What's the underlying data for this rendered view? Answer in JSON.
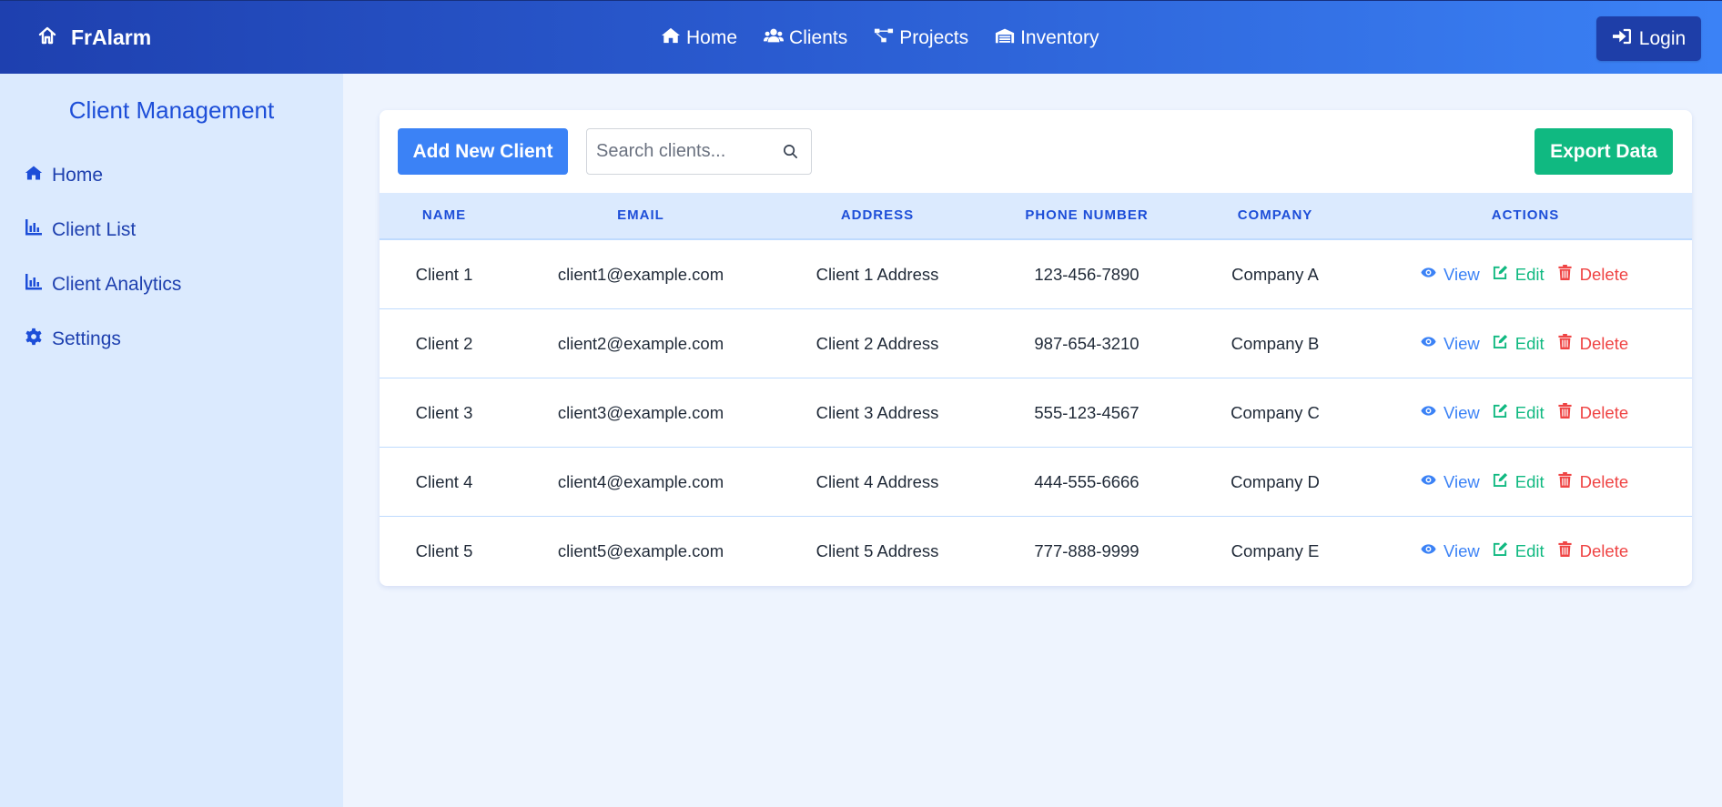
{
  "header": {
    "brand": "FrAlarm",
    "nav": [
      {
        "label": "Home",
        "icon": "home-icon"
      },
      {
        "label": "Clients",
        "icon": "users-icon"
      },
      {
        "label": "Projects",
        "icon": "project-diagram-icon"
      },
      {
        "label": "Inventory",
        "icon": "warehouse-icon"
      }
    ],
    "login_label": "Login"
  },
  "sidebar": {
    "title": "Client Management",
    "items": [
      {
        "label": "Home",
        "icon": "home-icon"
      },
      {
        "label": "Client List",
        "icon": "chart-bar-icon"
      },
      {
        "label": "Client Analytics",
        "icon": "chart-bar-icon"
      },
      {
        "label": "Settings",
        "icon": "gear-icon"
      }
    ]
  },
  "toolbar": {
    "add_label": "Add New Client",
    "search_placeholder": "Search clients...",
    "search_value": "",
    "export_label": "Export Data"
  },
  "table": {
    "columns": [
      "NAME",
      "EMAIL",
      "ADDRESS",
      "PHONE NUMBER",
      "COMPANY",
      "ACTIONS"
    ],
    "rows": [
      {
        "name": "Client 1",
        "email": "client1@example.com",
        "address": "Client 1 Address",
        "phone": "123-456-7890",
        "company": "Company A"
      },
      {
        "name": "Client 2",
        "email": "client2@example.com",
        "address": "Client 2 Address",
        "phone": "987-654-3210",
        "company": "Company B"
      },
      {
        "name": "Client 3",
        "email": "client3@example.com",
        "address": "Client 3 Address",
        "phone": "555-123-4567",
        "company": "Company C"
      },
      {
        "name": "Client 4",
        "email": "client4@example.com",
        "address": "Client 4 Address",
        "phone": "444-555-6666",
        "company": "Company D"
      },
      {
        "name": "Client 5",
        "email": "client5@example.com",
        "address": "Client 5 Address",
        "phone": "777-888-9999",
        "company": "Company E"
      }
    ],
    "actions": {
      "view": "View",
      "edit": "Edit",
      "delete": "Delete"
    }
  },
  "colors": {
    "primary": "#3b82f6",
    "header_start": "#1e40af",
    "success": "#10b981",
    "danger": "#ef4444",
    "sidebar_bg": "#dbeafe",
    "page_bg": "#eef4fe"
  }
}
